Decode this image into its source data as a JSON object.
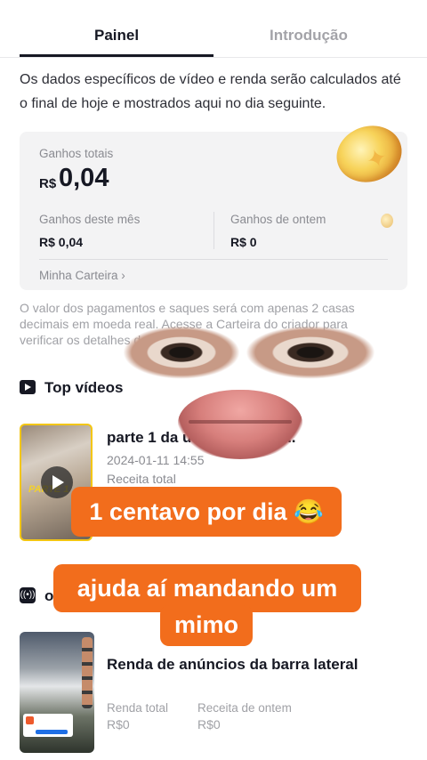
{
  "tabs": {
    "painel": "Painel",
    "introducao": "Introdução"
  },
  "intro_text": "Os dados específicos de vídeo e renda serão calculados até o final de hoje e mostrados aqui no dia seguinte.",
  "earnings": {
    "total_label": "Ganhos totais",
    "total_currency": "R$",
    "total_value": "0,04",
    "month_label": "Ganhos deste mês",
    "month_value": "R$ 0,04",
    "yesterday_label": "Ganhos de ontem",
    "yesterday_value": "R$ 0",
    "wallet_link": "Minha Carteira ›"
  },
  "note_text": "O valor dos pagamentos e saques será com apenas 2 casas decimais em moeda real. Acesse a Carteira do criador para verificar os detalhes da",
  "top_videos": {
    "header": "Top vídeos",
    "item": {
      "title": "parte 1 da          udio do kwai) ...",
      "date": "2024-01-11 14:55",
      "receita_label": "Receita total",
      "thumb_text": "PARTE 1"
    }
  },
  "ads": {
    "header_letter": "o",
    "title": "Renda de anúncios da barra lateral",
    "renda_label": "Renda total",
    "renda_value": "R$0",
    "ontem_label": "Receita de ontem",
    "ontem_value": "R$0"
  },
  "captions": {
    "line1": "1 centavo por dia 😂",
    "line2a": "ajuda aí mandando um",
    "line2b": "mimo"
  },
  "icons": {
    "coin": "coin-icon",
    "play": "play-square-icon",
    "ad": "broadcast-icon"
  },
  "colors": {
    "caption_bg": "#f26d1c",
    "thumb_border": "#f3c613"
  }
}
